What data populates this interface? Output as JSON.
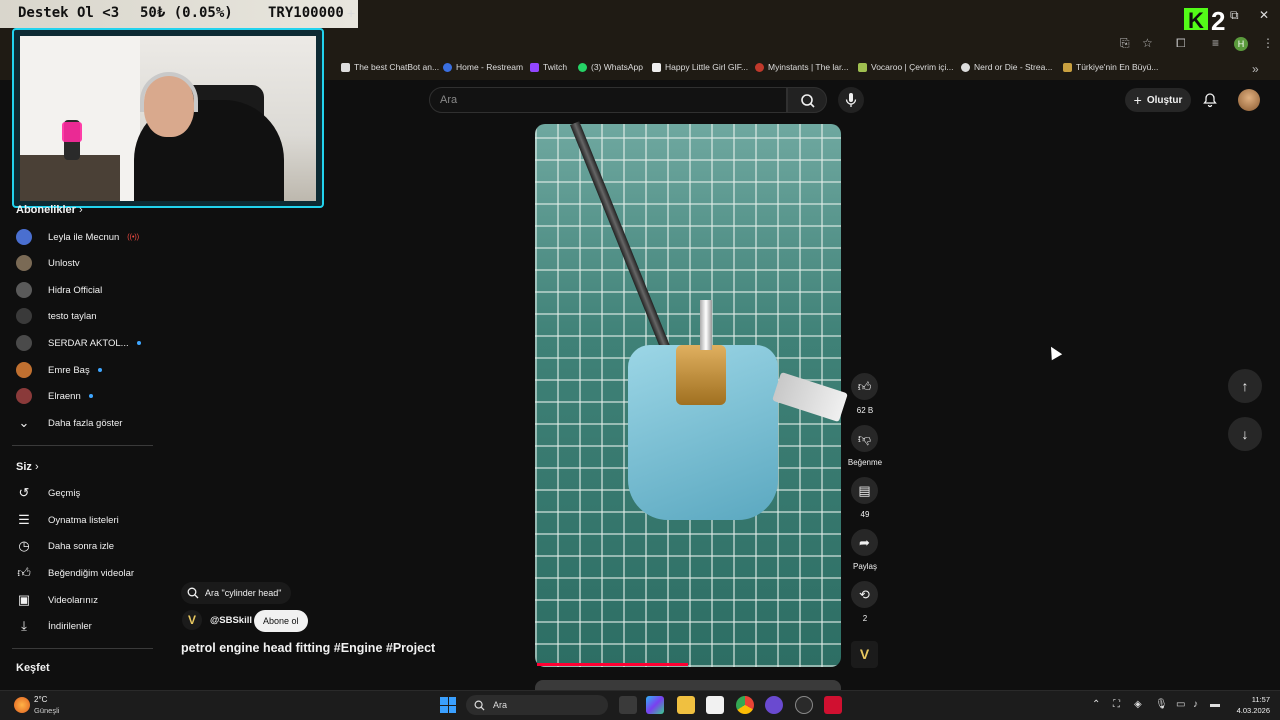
{
  "overlay": {
    "left_text": "Destek Ol <3",
    "middle_text": "50₺ (0.05%)",
    "right_text": "TRY100000",
    "kick_logo": "K",
    "kick_number": "2"
  },
  "bookmarks": [
    "The best ChatBot an...",
    "Home - Restream",
    "Twitch",
    "(3) WhatsApp",
    "Happy Little Girl GIF...",
    "Myinstants | The lar...",
    "Vocaroo | Çevrim içi...",
    "Nerd or Die - Strea...",
    "Türkiye'nin En Büyü..."
  ],
  "header": {
    "search_placeholder": "Ara",
    "create_label": "Oluştur"
  },
  "sidebar": {
    "subscriptions_title": "Abonelikler",
    "subscriptions": [
      {
        "label": "Leyla ile Mecnun",
        "badge": "live",
        "color": "#4a6fd0"
      },
      {
        "label": "Unlostv",
        "badge": "",
        "color": "#7a6a55"
      },
      {
        "label": "Hidra Official",
        "badge": "",
        "color": "#5a5a5a"
      },
      {
        "label": "testo taylan",
        "badge": "",
        "color": "#3a3a3a"
      },
      {
        "label": "SERDAR AKTOL...",
        "badge": "dot",
        "color": "#4a4a4a"
      },
      {
        "label": "Emre Baş",
        "badge": "dot",
        "color": "#c07030"
      },
      {
        "label": "Elraenn",
        "badge": "dot",
        "color": "#8a3a3a"
      }
    ],
    "show_more": "Daha fazla göster",
    "you_title": "Siz",
    "you_items": [
      "Geçmiş",
      "Oynatma listeleri",
      "Daha sonra izle",
      "Beğendiğim videolar",
      "Videolarınız",
      "İndirilenler"
    ],
    "explore_title": "Keşfet"
  },
  "short": {
    "search_chip": "Ara \"cylinder head\"",
    "channel_handle": "@SBSkill",
    "subscribe_label": "Abone ol",
    "title": "petrol engine head fitting #Engine #Project",
    "progress_fraction": 0.5
  },
  "actions": {
    "like_count": "62 B",
    "dislike_label": "Beğenme",
    "comment_count": "49",
    "share_label": "Paylaş",
    "remix_count": "2"
  },
  "taskbar": {
    "weather_temp": "2°C",
    "weather_desc": "Güneşli",
    "search_label": "Ara",
    "time": "11:57",
    "date": "4.03.2026"
  },
  "colors": {
    "accent": "#ff0033",
    "overlay_border": "#22d3ee",
    "kick_green": "#53fc18",
    "background": "#0f0f0f"
  }
}
